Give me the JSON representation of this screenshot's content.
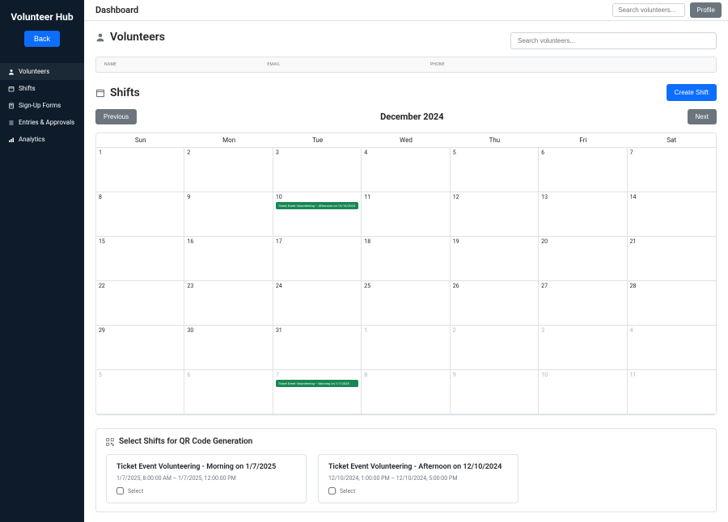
{
  "sidebar": {
    "title": "Volunteer Hub",
    "back": "Back",
    "items": [
      {
        "label": "Volunteers"
      },
      {
        "label": "Shifts"
      },
      {
        "label": "Sign-Up Forms"
      },
      {
        "label": "Entries & Approvals"
      },
      {
        "label": "Analytics"
      }
    ]
  },
  "topbar": {
    "title": "Dashboard",
    "search_placeholder": "Search volunteers...",
    "profile": "Profile"
  },
  "volunteers": {
    "title": "Volunteers",
    "search_placeholder": "Search volunteers...",
    "columns": {
      "name": "NAME",
      "email": "EMAIL",
      "phone": "PHONE"
    }
  },
  "shifts": {
    "title": "Shifts",
    "create": "Create Shift",
    "prev": "Previous",
    "next": "Next",
    "month": "December 2024",
    "days": [
      "Sun",
      "Mon",
      "Tue",
      "Wed",
      "Thu",
      "Fri",
      "Sat"
    ],
    "weeks": [
      [
        {
          "d": "1"
        },
        {
          "d": "2"
        },
        {
          "d": "3"
        },
        {
          "d": "4"
        },
        {
          "d": "5"
        },
        {
          "d": "6"
        },
        {
          "d": "7"
        }
      ],
      [
        {
          "d": "8"
        },
        {
          "d": "9"
        },
        {
          "d": "10",
          "event": "Ticket Event Volunteering – Afternoon on 12/10/2024"
        },
        {
          "d": "11"
        },
        {
          "d": "12"
        },
        {
          "d": "13"
        },
        {
          "d": "14"
        }
      ],
      [
        {
          "d": "15"
        },
        {
          "d": "16"
        },
        {
          "d": "17"
        },
        {
          "d": "18"
        },
        {
          "d": "19"
        },
        {
          "d": "20"
        },
        {
          "d": "21"
        }
      ],
      [
        {
          "d": "22"
        },
        {
          "d": "23"
        },
        {
          "d": "24"
        },
        {
          "d": "25"
        },
        {
          "d": "26"
        },
        {
          "d": "27"
        },
        {
          "d": "28"
        }
      ],
      [
        {
          "d": "29"
        },
        {
          "d": "30"
        },
        {
          "d": "31"
        },
        {
          "d": "1",
          "muted": true
        },
        {
          "d": "2",
          "muted": true
        },
        {
          "d": "3",
          "muted": true
        },
        {
          "d": "4",
          "muted": true
        }
      ],
      [
        {
          "d": "5",
          "muted": true
        },
        {
          "d": "6",
          "muted": true
        },
        {
          "d": "7",
          "muted": true,
          "event": "Ticket Event Volunteering – Morning on 1/7/2025"
        },
        {
          "d": "8",
          "muted": true
        },
        {
          "d": "9",
          "muted": true
        },
        {
          "d": "10",
          "muted": true
        },
        {
          "d": "11",
          "muted": true
        }
      ]
    ]
  },
  "qr": {
    "title": "Select Shifts for QR Code Generation",
    "select_label": "Select",
    "cards": [
      {
        "title": "Ticket Event Volunteering - Morning on 1/7/2025",
        "time": "1/7/2025, 8:00:00 AM – 1/7/2025, 12:00:00 PM"
      },
      {
        "title": "Ticket Event Volunteering - Afternoon on 12/10/2024",
        "time": "12/10/2024, 1:00:00 PM – 12/10/2024, 5:00:00 PM"
      }
    ]
  }
}
